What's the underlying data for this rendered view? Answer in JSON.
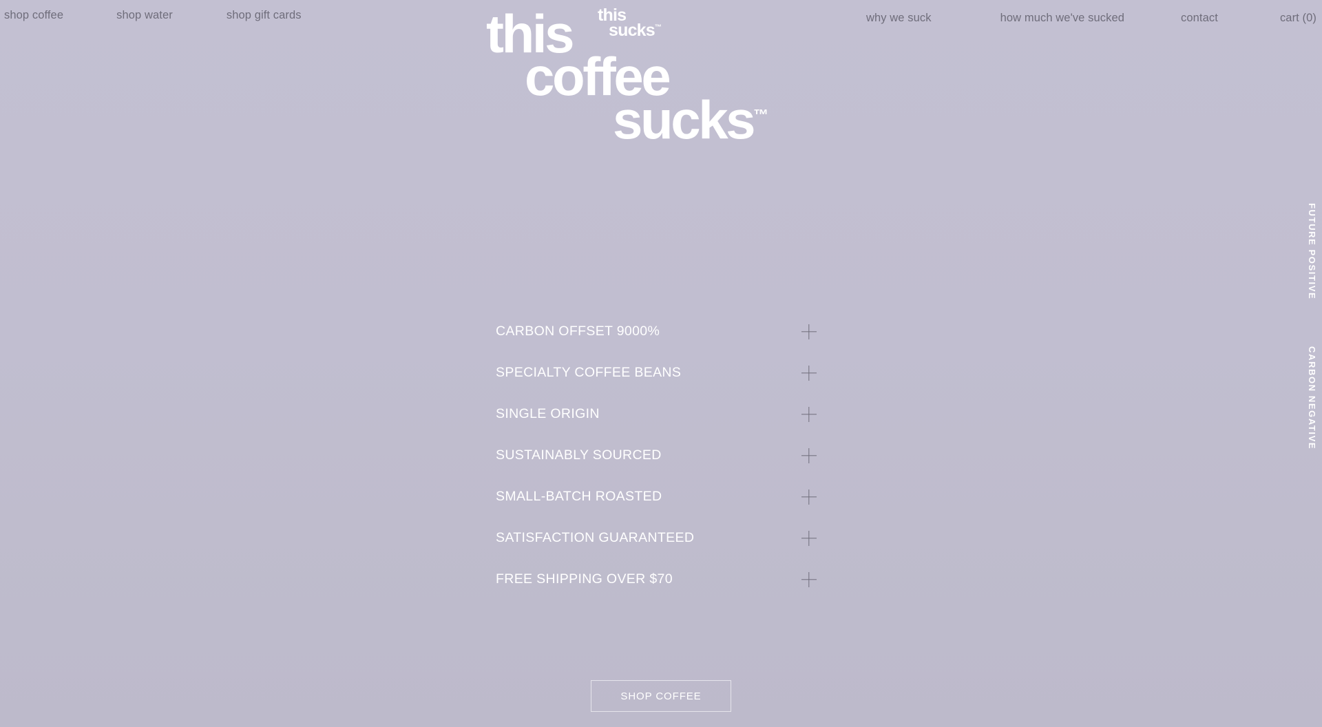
{
  "theme": {
    "background_top": "#c3c0d2",
    "background_bottom": "#bdbacb",
    "text_white": "#ffffff",
    "nav_text": "#6f6d7b",
    "icon_gray": "#6f6d7b"
  },
  "nav": {
    "left_items": [
      {
        "label": "shop coffee",
        "name": "nav-shop-coffee"
      },
      {
        "label": "shop water",
        "name": "nav-shop-water"
      },
      {
        "label": "shop gift cards",
        "name": "nav-shop-gift-cards"
      }
    ],
    "right_items": [
      {
        "label": "why we suck",
        "name": "nav-why-we-suck"
      },
      {
        "label": "how much we've sucked",
        "name": "nav-how-much-weve-sucked"
      },
      {
        "label": "contact",
        "name": "nav-contact"
      },
      {
        "label": "cart (0)",
        "name": "nav-cart"
      }
    ]
  },
  "logo": {
    "small_line1": "this",
    "small_line2": "sucks",
    "small_tm": "™",
    "big_line1": "this",
    "big_line2": "coffee",
    "big_line3": "sucks",
    "big_tm": "™"
  },
  "side_labels": {
    "future_positive": "FUTURE POSITIVE",
    "carbon_negative": "CARBON NEGATIVE"
  },
  "features": {
    "items": [
      {
        "label": "CARBON OFFSET 9000%",
        "icon": "plus-icon"
      },
      {
        "label": "SPECIALTY COFFEE BEANS",
        "icon": "plus-icon"
      },
      {
        "label": "SINGLE ORIGIN",
        "icon": "plus-icon"
      },
      {
        "label": "SUSTAINABLY SOURCED",
        "icon": "plus-icon"
      },
      {
        "label": "SMALL-BATCH ROASTED",
        "icon": "plus-icon"
      },
      {
        "label": "SATISFACTION GUARANTEED",
        "icon": "plus-icon"
      },
      {
        "label": "FREE SHIPPING OVER $70",
        "icon": "plus-icon"
      }
    ]
  },
  "cta": {
    "label": "SHOP COFFEE"
  }
}
